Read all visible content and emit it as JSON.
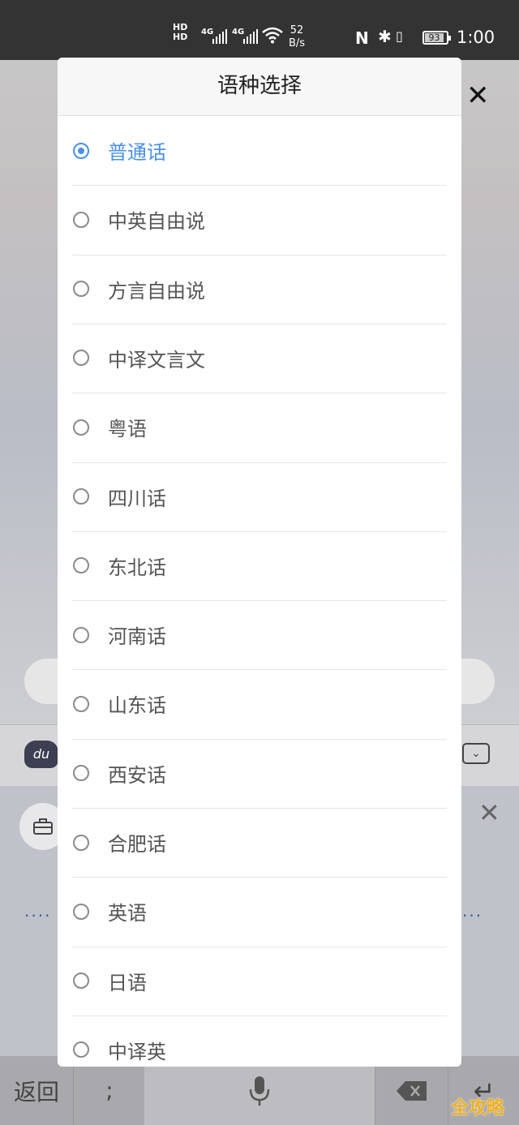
{
  "status_bar": {
    "hd1": "HD",
    "hd2": "HD",
    "net1": "4G",
    "net2": "4G",
    "speed_value": "52",
    "speed_unit": "B/s",
    "battery": "93",
    "time": "1:00"
  },
  "background": {
    "keyboard": {
      "back_label": "返回",
      "semicolon_label": ";"
    },
    "logo_text": "du",
    "watermark": "全攻略"
  },
  "dialog": {
    "title": "语种选择",
    "selected_index": 0,
    "options": [
      {
        "label": "普通话",
        "checked": true
      },
      {
        "label": "中英自由说",
        "checked": false
      },
      {
        "label": "方言自由说",
        "checked": false
      },
      {
        "label": "中译文言文",
        "checked": false
      },
      {
        "label": "粤语",
        "checked": false
      },
      {
        "label": "四川话",
        "checked": false
      },
      {
        "label": "东北话",
        "checked": false
      },
      {
        "label": "河南话",
        "checked": false
      },
      {
        "label": "山东话",
        "checked": false
      },
      {
        "label": "西安话",
        "checked": false
      },
      {
        "label": "合肥话",
        "checked": false
      },
      {
        "label": "英语",
        "checked": false
      },
      {
        "label": "日语",
        "checked": false
      },
      {
        "label": "中译英",
        "checked": false
      }
    ]
  },
  "colors": {
    "accent": "#4a90e2",
    "status_bar_bg": "#333333"
  },
  "icons": {
    "close": "close-icon",
    "mic": "microphone-icon",
    "delete": "backspace-icon",
    "enter": "enter-icon",
    "collapse": "chevron-down-icon",
    "toolbox": "briefcase-icon"
  }
}
